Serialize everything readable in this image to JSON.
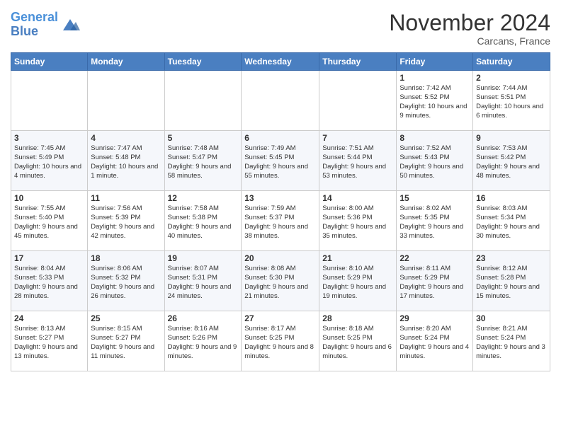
{
  "logo": {
    "line1": "General",
    "line2": "Blue"
  },
  "title": "November 2024",
  "location": "Carcans, France",
  "days_of_week": [
    "Sunday",
    "Monday",
    "Tuesday",
    "Wednesday",
    "Thursday",
    "Friday",
    "Saturday"
  ],
  "weeks": [
    [
      {
        "num": "",
        "info": ""
      },
      {
        "num": "",
        "info": ""
      },
      {
        "num": "",
        "info": ""
      },
      {
        "num": "",
        "info": ""
      },
      {
        "num": "",
        "info": ""
      },
      {
        "num": "1",
        "info": "Sunrise: 7:42 AM\nSunset: 5:52 PM\nDaylight: 10 hours and 9 minutes."
      },
      {
        "num": "2",
        "info": "Sunrise: 7:44 AM\nSunset: 5:51 PM\nDaylight: 10 hours and 6 minutes."
      }
    ],
    [
      {
        "num": "3",
        "info": "Sunrise: 7:45 AM\nSunset: 5:49 PM\nDaylight: 10 hours and 4 minutes."
      },
      {
        "num": "4",
        "info": "Sunrise: 7:47 AM\nSunset: 5:48 PM\nDaylight: 10 hours and 1 minute."
      },
      {
        "num": "5",
        "info": "Sunrise: 7:48 AM\nSunset: 5:47 PM\nDaylight: 9 hours and 58 minutes."
      },
      {
        "num": "6",
        "info": "Sunrise: 7:49 AM\nSunset: 5:45 PM\nDaylight: 9 hours and 55 minutes."
      },
      {
        "num": "7",
        "info": "Sunrise: 7:51 AM\nSunset: 5:44 PM\nDaylight: 9 hours and 53 minutes."
      },
      {
        "num": "8",
        "info": "Sunrise: 7:52 AM\nSunset: 5:43 PM\nDaylight: 9 hours and 50 minutes."
      },
      {
        "num": "9",
        "info": "Sunrise: 7:53 AM\nSunset: 5:42 PM\nDaylight: 9 hours and 48 minutes."
      }
    ],
    [
      {
        "num": "10",
        "info": "Sunrise: 7:55 AM\nSunset: 5:40 PM\nDaylight: 9 hours and 45 minutes."
      },
      {
        "num": "11",
        "info": "Sunrise: 7:56 AM\nSunset: 5:39 PM\nDaylight: 9 hours and 42 minutes."
      },
      {
        "num": "12",
        "info": "Sunrise: 7:58 AM\nSunset: 5:38 PM\nDaylight: 9 hours and 40 minutes."
      },
      {
        "num": "13",
        "info": "Sunrise: 7:59 AM\nSunset: 5:37 PM\nDaylight: 9 hours and 38 minutes."
      },
      {
        "num": "14",
        "info": "Sunrise: 8:00 AM\nSunset: 5:36 PM\nDaylight: 9 hours and 35 minutes."
      },
      {
        "num": "15",
        "info": "Sunrise: 8:02 AM\nSunset: 5:35 PM\nDaylight: 9 hours and 33 minutes."
      },
      {
        "num": "16",
        "info": "Sunrise: 8:03 AM\nSunset: 5:34 PM\nDaylight: 9 hours and 30 minutes."
      }
    ],
    [
      {
        "num": "17",
        "info": "Sunrise: 8:04 AM\nSunset: 5:33 PM\nDaylight: 9 hours and 28 minutes."
      },
      {
        "num": "18",
        "info": "Sunrise: 8:06 AM\nSunset: 5:32 PM\nDaylight: 9 hours and 26 minutes."
      },
      {
        "num": "19",
        "info": "Sunrise: 8:07 AM\nSunset: 5:31 PM\nDaylight: 9 hours and 24 minutes."
      },
      {
        "num": "20",
        "info": "Sunrise: 8:08 AM\nSunset: 5:30 PM\nDaylight: 9 hours and 21 minutes."
      },
      {
        "num": "21",
        "info": "Sunrise: 8:10 AM\nSunset: 5:29 PM\nDaylight: 9 hours and 19 minutes."
      },
      {
        "num": "22",
        "info": "Sunrise: 8:11 AM\nSunset: 5:29 PM\nDaylight: 9 hours and 17 minutes."
      },
      {
        "num": "23",
        "info": "Sunrise: 8:12 AM\nSunset: 5:28 PM\nDaylight: 9 hours and 15 minutes."
      }
    ],
    [
      {
        "num": "24",
        "info": "Sunrise: 8:13 AM\nSunset: 5:27 PM\nDaylight: 9 hours and 13 minutes."
      },
      {
        "num": "25",
        "info": "Sunrise: 8:15 AM\nSunset: 5:27 PM\nDaylight: 9 hours and 11 minutes."
      },
      {
        "num": "26",
        "info": "Sunrise: 8:16 AM\nSunset: 5:26 PM\nDaylight: 9 hours and 9 minutes."
      },
      {
        "num": "27",
        "info": "Sunrise: 8:17 AM\nSunset: 5:25 PM\nDaylight: 9 hours and 8 minutes."
      },
      {
        "num": "28",
        "info": "Sunrise: 8:18 AM\nSunset: 5:25 PM\nDaylight: 9 hours and 6 minutes."
      },
      {
        "num": "29",
        "info": "Sunrise: 8:20 AM\nSunset: 5:24 PM\nDaylight: 9 hours and 4 minutes."
      },
      {
        "num": "30",
        "info": "Sunrise: 8:21 AM\nSunset: 5:24 PM\nDaylight: 9 hours and 3 minutes."
      }
    ]
  ]
}
